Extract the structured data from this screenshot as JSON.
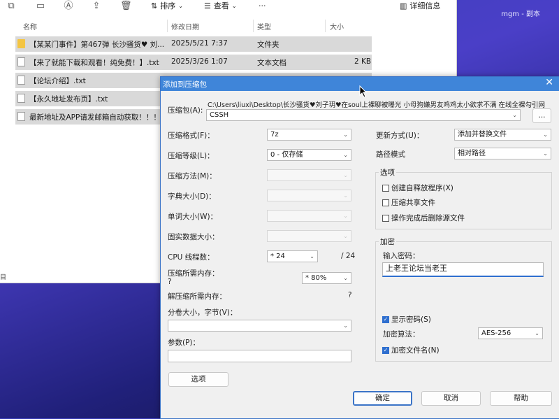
{
  "explorer": {
    "toolbar": {
      "sort_label": "排序",
      "view_label": "查看",
      "more": "···",
      "details_label": "详细信息"
    },
    "columns": {
      "name": "名称",
      "date": "修改日期",
      "type": "类型",
      "size": "大小"
    },
    "files": [
      {
        "icon": "folder-icon",
        "name": "【某某门事件】第467弹 长沙骚货♥ 刘...",
        "date": "2025/5/21 7:37",
        "type": "文件夹",
        "size": ""
      },
      {
        "icon": "document-icon",
        "name": "【来了就能下载和观看！纯免费！】.txt",
        "date": "2025/3/26 1:07",
        "type": "文本文档",
        "size": "2 KB"
      },
      {
        "icon": "document-icon",
        "name": "【论坛介绍】.txt",
        "date": "",
        "type": "",
        "size": ""
      },
      {
        "icon": "document-icon",
        "name": "【永久地址发布页】.txt",
        "date": "",
        "type": "",
        "size": ""
      },
      {
        "icon": "document-icon",
        "name": "最新地址及APP请发邮箱自动获取！！！",
        "date": "",
        "type": "",
        "size": ""
      }
    ],
    "status_fragment": "目"
  },
  "desktop": {
    "corner_text": "mgm - 副本"
  },
  "dialog": {
    "title": "添加到压缩包",
    "archive_label": "压缩包(A):",
    "archive_path": "C:\\Users\\liuxi\\Desktop\\长沙骚货♥刘子玥♥在soul上裸聊被曝光 小母狗嫌男友鸡鸡太小欲求不满 在线全裸勾引网",
    "archive_name": "CSSH",
    "browse_label": "...",
    "left": {
      "format_label": "压缩格式(F)：",
      "format_value": "7z",
      "level_label": "压缩等级(L)：",
      "level_value": "0 - 仅存储",
      "method_label": "压缩方法(M)：",
      "dict_label": "字典大小(D)：",
      "word_label": "单词大小(W)：",
      "solid_label": "固实数据大小：",
      "cpu_label": "CPU 线程数：",
      "cpu_value": "* 24",
      "cpu_total": "/ 24",
      "mem_label": "压缩所需内存：",
      "mem_q": "?",
      "mem_value": "* 80%",
      "demem_label": "解压缩所需内存：",
      "demem_value": "?",
      "split_label": "分卷大小，字节(V)：",
      "params_label": "参数(P)：",
      "options_button": "选项"
    },
    "right": {
      "update_label": "更新方式(U)：",
      "update_value": "添加并替换文件",
      "pathmode_label": "路径模式",
      "pathmode_value": "相对路径",
      "options_group": "选项",
      "sfx_label": "创建自释放程序(X)",
      "shared_label": "压缩共享文件",
      "delete_label": "操作完成后删除源文件",
      "encrypt_group": "加密",
      "password_label": "输入密码：",
      "password_value": "上老王论坛当老王",
      "show_password_label": "显示密码(S)",
      "enc_method_label": "加密算法：",
      "enc_method_value": "AES-256",
      "enc_names_label": "加密文件名(N)"
    },
    "buttons": {
      "ok": "确定",
      "cancel": "取消",
      "help": "帮助"
    }
  }
}
